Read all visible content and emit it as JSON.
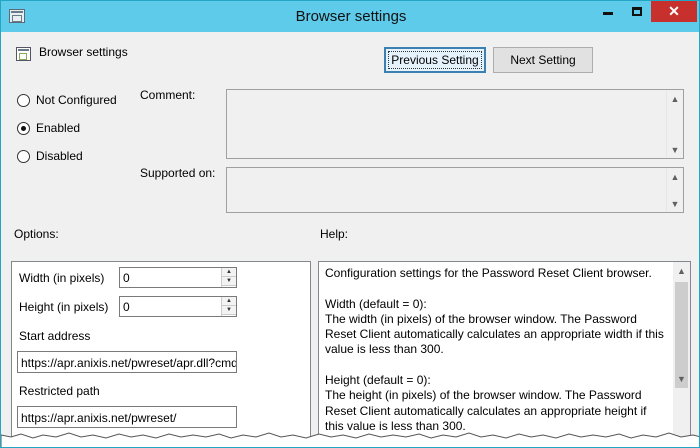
{
  "window": {
    "title": "Browser settings",
    "icon": "policy-icon",
    "controls": {
      "minimize": "minimize-icon",
      "maximize": "maximize-icon",
      "close": "✕"
    }
  },
  "header": {
    "policy_name": "Browser settings",
    "prev_label": "Previous Setting",
    "next_label": "Next Setting"
  },
  "state": {
    "options": [
      {
        "label": "Not Configured",
        "checked": false
      },
      {
        "label": "Enabled",
        "checked": true
      },
      {
        "label": "Disabled",
        "checked": false
      }
    ]
  },
  "comment": {
    "label": "Comment:",
    "value": ""
  },
  "supported": {
    "label": "Supported on:",
    "value": ""
  },
  "options_section": {
    "label": "Options:",
    "width_label": "Width (in pixels)",
    "width_value": "0",
    "height_label": "Height (in pixels)",
    "height_value": "0",
    "start_label": "Start address",
    "start_value": "https://apr.anixis.net/pwreset/apr.dll?cmd",
    "restricted_label": "Restricted path",
    "restricted_value": "https://apr.anixis.net/pwreset/"
  },
  "help_section": {
    "label": "Help:",
    "text": "Configuration settings for the Password Reset Client browser.\n\nWidth (default = 0):\nThe width (in pixels) of the browser window. The Password Reset Client automatically calculates an appropriate width if this value is less than 300.\n\nHeight (default = 0):\nThe height (in pixels) of the browser window. The Password Reset Client automatically calculates an appropriate height if this value is less than 300."
  },
  "colors": {
    "titlebar": "#5ecbea",
    "close": "#c7302d",
    "dialog_bg": "#f0f0f0"
  }
}
